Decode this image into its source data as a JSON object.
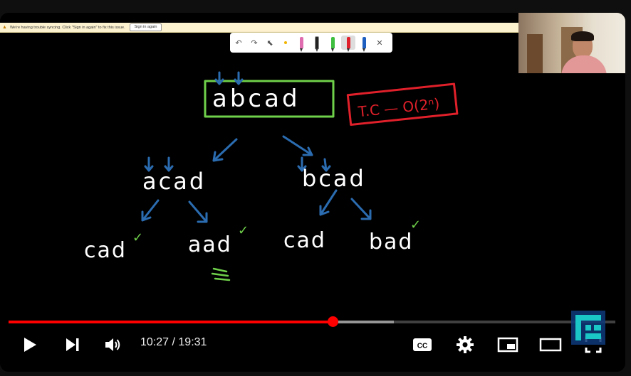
{
  "sync_bar": {
    "message": "We're having trouble syncing. Click \"Sign in again\" to fix this issue.",
    "button": "Sign in again"
  },
  "whiteboard": {
    "root": "abcad",
    "complexity": "T.C — O(2ⁿ)",
    "level1": [
      "acad",
      "bcad"
    ],
    "level2": [
      "cad",
      "aad",
      "cad",
      "bad"
    ],
    "check_mark": "✓",
    "count": "3",
    "colors": {
      "ink": "#ffffff",
      "arrow": "#2b6cb0",
      "box": "#6fd04a",
      "note": "#e0202a",
      "check": "#6fd04a"
    }
  },
  "player": {
    "current_time": "10:27",
    "separator": " / ",
    "duration": "19:31",
    "progress": 0.535,
    "buffered": 0.635,
    "progress_color": "#ff0000",
    "icons": [
      "play-icon",
      "next-icon",
      "volume-icon",
      "captions-icon",
      "settings-icon",
      "miniplayer-icon",
      "theater-icon",
      "fullscreen-icon"
    ]
  }
}
